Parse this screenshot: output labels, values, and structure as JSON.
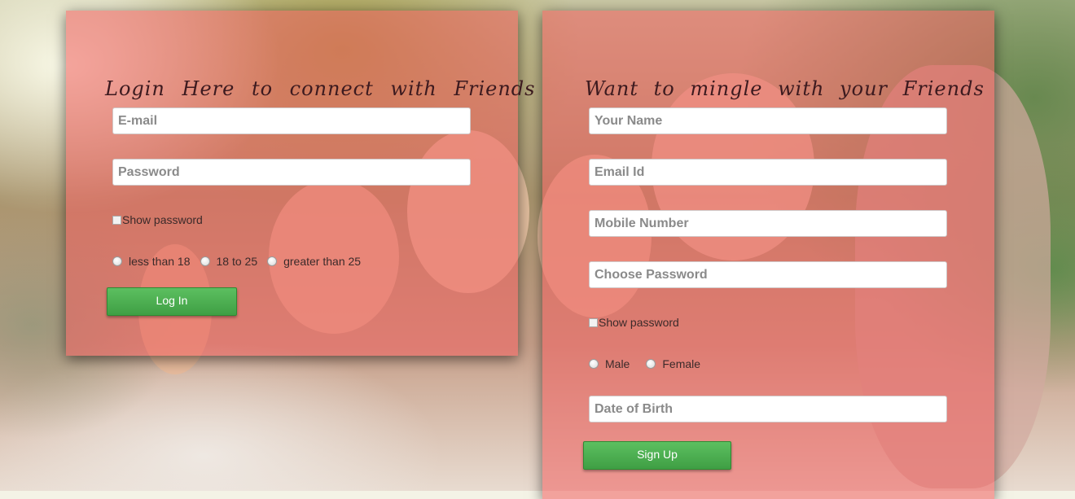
{
  "login": {
    "title": "Login Here to connect with Friends",
    "email_placeholder": "E-mail",
    "password_placeholder": "Password",
    "show_password_label": "Show password",
    "age_options": [
      "less than 18",
      "18 to 25",
      "greater than 25"
    ],
    "submit_label": "Log In"
  },
  "signup": {
    "title": "Want to mingle with your Friends",
    "name_placeholder": "Your Name",
    "email_placeholder": "Email Id",
    "mobile_placeholder": "Mobile Number",
    "password_placeholder": "Choose Password",
    "show_password_label": "Show password",
    "gender_options": [
      "Male",
      "Female"
    ],
    "dob_placeholder": "Date of Birth",
    "submit_label": "Sign Up"
  },
  "colors": {
    "panel_overlay": "#f05f5f",
    "button_green": "#4cae50",
    "title_text": "#3c1a1f"
  }
}
